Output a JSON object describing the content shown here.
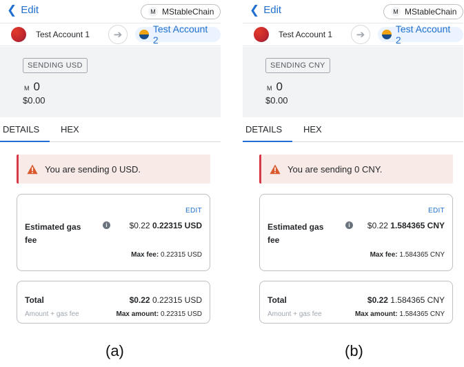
{
  "panels": [
    {
      "back_label": "Edit",
      "network_label": "MStableChain",
      "network_avatar": "M",
      "from_account": "Test Account 1",
      "to_account": "Test Account 2",
      "sending_badge": "SENDING USD",
      "currency_symbol": "M",
      "amount": "0",
      "fiat_amount": "$0.00",
      "tabs": [
        "DETAILS",
        "HEX"
      ],
      "alert_text": "You are sending 0 USD.",
      "edit_label": "EDIT",
      "gas_label": "Estimated gas fee",
      "gas_fiat": "$0.22",
      "gas_value": "0.22315 USD",
      "max_fee_label": "Max fee:",
      "max_fee_value": "0.22315 USD",
      "total_label": "Total",
      "total_sub": "Amount + gas fee",
      "total_fiat": "$0.22",
      "total_value": "0.22315 USD",
      "max_amount_label": "Max amount:",
      "max_amount_value": "0.22315 USD"
    },
    {
      "back_label": "Edit",
      "network_label": "MStableChain",
      "network_avatar": "M",
      "from_account": "Test Account 1",
      "to_account": "Test Account 2",
      "sending_badge": "SENDING CNY",
      "currency_symbol": "M",
      "amount": "0",
      "fiat_amount": "$0.00",
      "tabs": [
        "DETAILS",
        "HEX"
      ],
      "alert_text": "You are sending 0 CNY.",
      "edit_label": "EDIT",
      "gas_label": "Estimated gas fee",
      "gas_fiat": "$0.22",
      "gas_value": "1.584365 CNY",
      "max_fee_label": "Max fee:",
      "max_fee_value": "1.584365 CNY",
      "total_label": "Total",
      "total_sub": "Amount + gas fee",
      "total_fiat": "$0.22",
      "total_value": "1.584365 CNY",
      "max_amount_label": "Max amount:",
      "max_amount_value": "1.584365 CNY"
    }
  ],
  "captions": [
    "(a)",
    "(b)"
  ],
  "colors": {
    "accent": "#1f6fd0",
    "alert_bg": "#f8eae6",
    "alert_border": "#d73847",
    "warning_icon": "#d9592c"
  },
  "icons": {
    "back": "chevron-left-icon",
    "arrow": "arrow-right-icon",
    "warning": "warning-triangle-icon",
    "info": "info-icon"
  }
}
